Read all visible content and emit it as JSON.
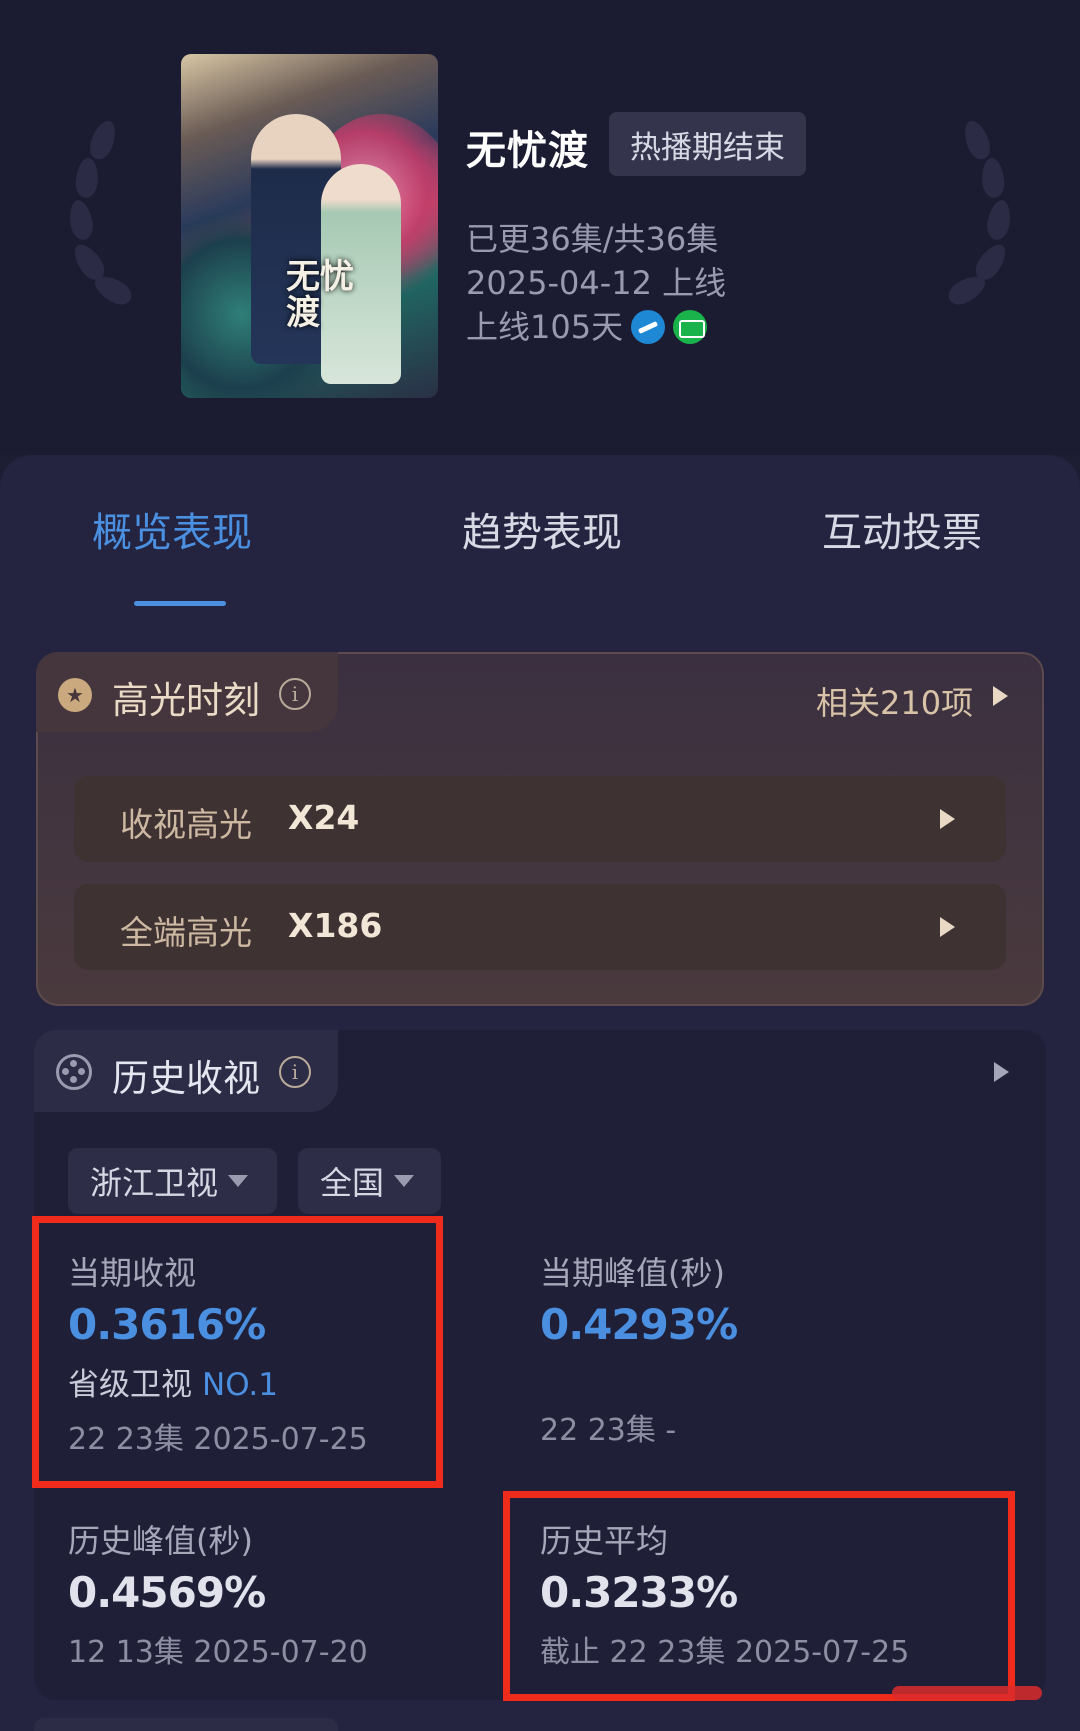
{
  "header": {
    "poster_title": "无忧渡",
    "title": "无忧渡",
    "status_badge": "热播期结束",
    "episodes": "已更36集/共36集",
    "premiere": "2025-04-12 上线",
    "days_online": "上线105天",
    "channels": [
      "zhejiang-tv-icon",
      "iqiyi-icon"
    ]
  },
  "tabs": [
    {
      "label": "概览表现",
      "active": true
    },
    {
      "label": "趋势表现",
      "active": false
    },
    {
      "label": "互动投票",
      "active": false
    }
  ],
  "highlights": {
    "title": "高光时刻",
    "count_text": "相关210项",
    "rows": [
      {
        "label": "收视高光",
        "value": "X24"
      },
      {
        "label": "全端高光",
        "value": "X186"
      }
    ]
  },
  "history": {
    "title": "历史收视",
    "filters": {
      "channel": "浙江卫视",
      "region": "全国"
    },
    "current": {
      "label": "当期收视",
      "value": "0.3616%",
      "rank_label": "省级卫视",
      "rank": "NO.1",
      "sub": "22 23集 2025-07-25"
    },
    "current_peak": {
      "label": "当期峰值(秒)",
      "value": "0.4293%",
      "sub": "22 23集 -"
    },
    "history_peak": {
      "label": "历史峰值(秒)",
      "value": "0.4569%",
      "sub": "12 13集 2025-07-20"
    },
    "history_avg": {
      "label": "历史平均",
      "value": "0.3233%",
      "sub": "截止 22 23集 2025-07-25"
    }
  },
  "colors": {
    "accent": "#4a8fe0",
    "annotation_red": "#ef2b1c",
    "background": "#1d1d33"
  }
}
